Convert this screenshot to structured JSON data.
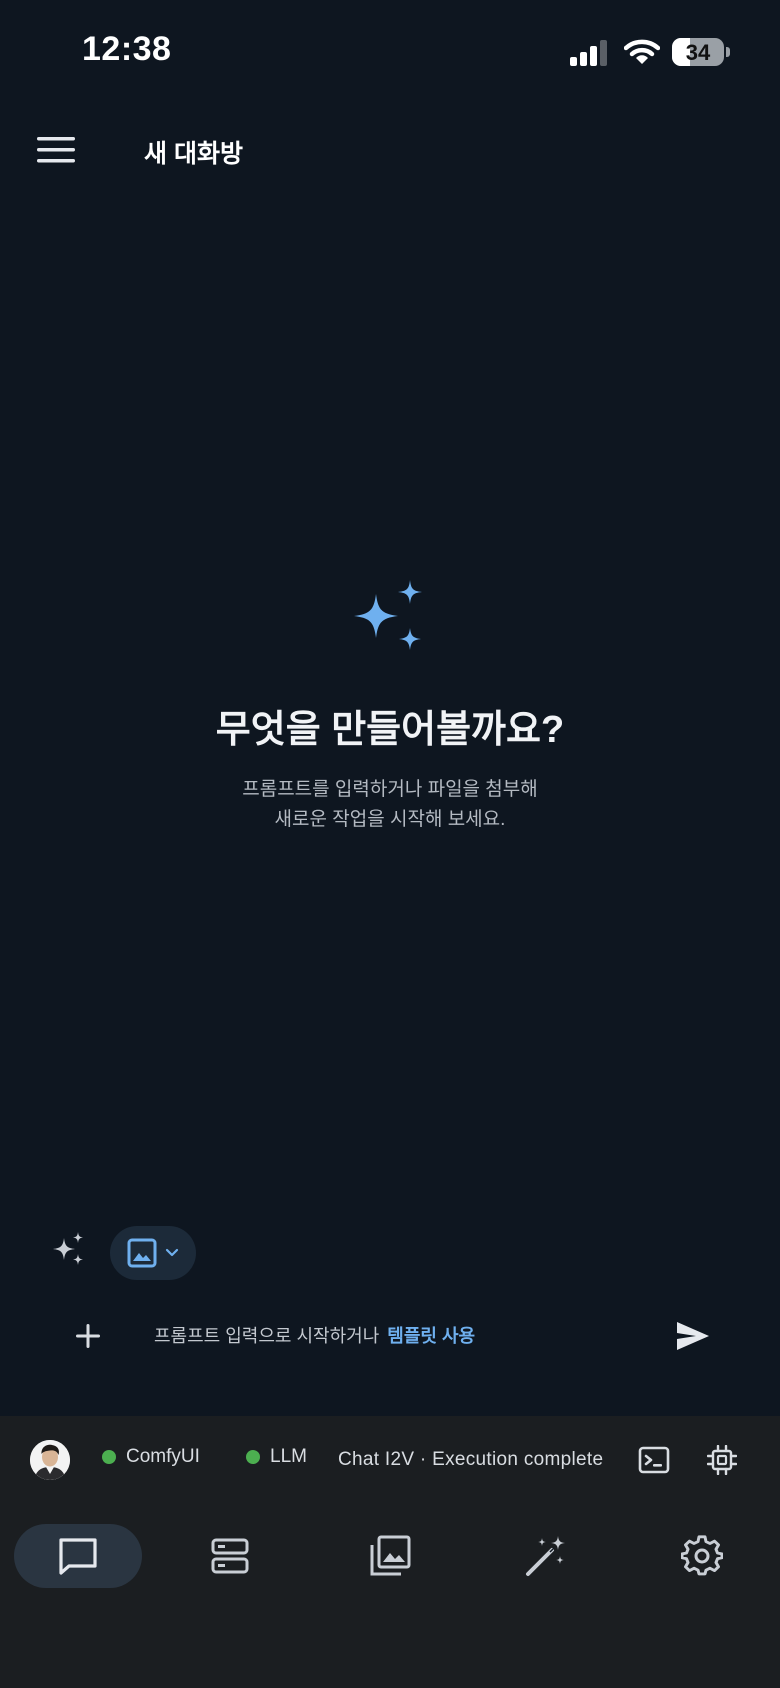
{
  "status_bar": {
    "time": "12:38",
    "battery_level": "34",
    "battery_fraction": 0.34,
    "signal_icon": "cellular-signal-icon",
    "wifi_icon": "wifi-icon"
  },
  "header": {
    "title": "새 대화방",
    "menu_icon": "hamburger-menu-icon"
  },
  "empty_state": {
    "icon": "sparkles-icon",
    "heading": "무엇을 만들어볼까요?",
    "subtitle_line1": "프롬프트를 입력하거나 파일을 첨부해",
    "subtitle_line2": "새로운 작업을 시작해 보세요."
  },
  "toolbar": {
    "sparkle_icon": "sparkles-icon",
    "media_type_icon": "image-icon",
    "media_dropdown_icon": "chevron-down-icon"
  },
  "composer": {
    "placeholder": "프롬프트 입력으로 시작하거나",
    "template_link": "템플릿 사용",
    "add_icon": "plus-icon",
    "send_icon": "send-icon"
  },
  "status_strip": {
    "comfyui_label": "ComfyUI",
    "llm_label": "LLM",
    "execution_status": "Chat I2V · Execution complete",
    "terminal_icon": "terminal-icon",
    "chip_icon": "cpu-chip-icon"
  },
  "tabs": [
    {
      "name": "chat",
      "icon": "chat-bubble-icon",
      "active": true
    },
    {
      "name": "servers",
      "icon": "server-icon",
      "active": false
    },
    {
      "name": "gallery",
      "icon": "gallery-icon",
      "active": false
    },
    {
      "name": "magic",
      "icon": "magic-wand-icon",
      "active": false
    },
    {
      "name": "settings",
      "icon": "gear-icon",
      "active": false
    }
  ],
  "colors": {
    "background": "#0e1620",
    "accent": "#6fb0ef",
    "status_ok": "#4caf50",
    "panel": "#1b1e21"
  }
}
